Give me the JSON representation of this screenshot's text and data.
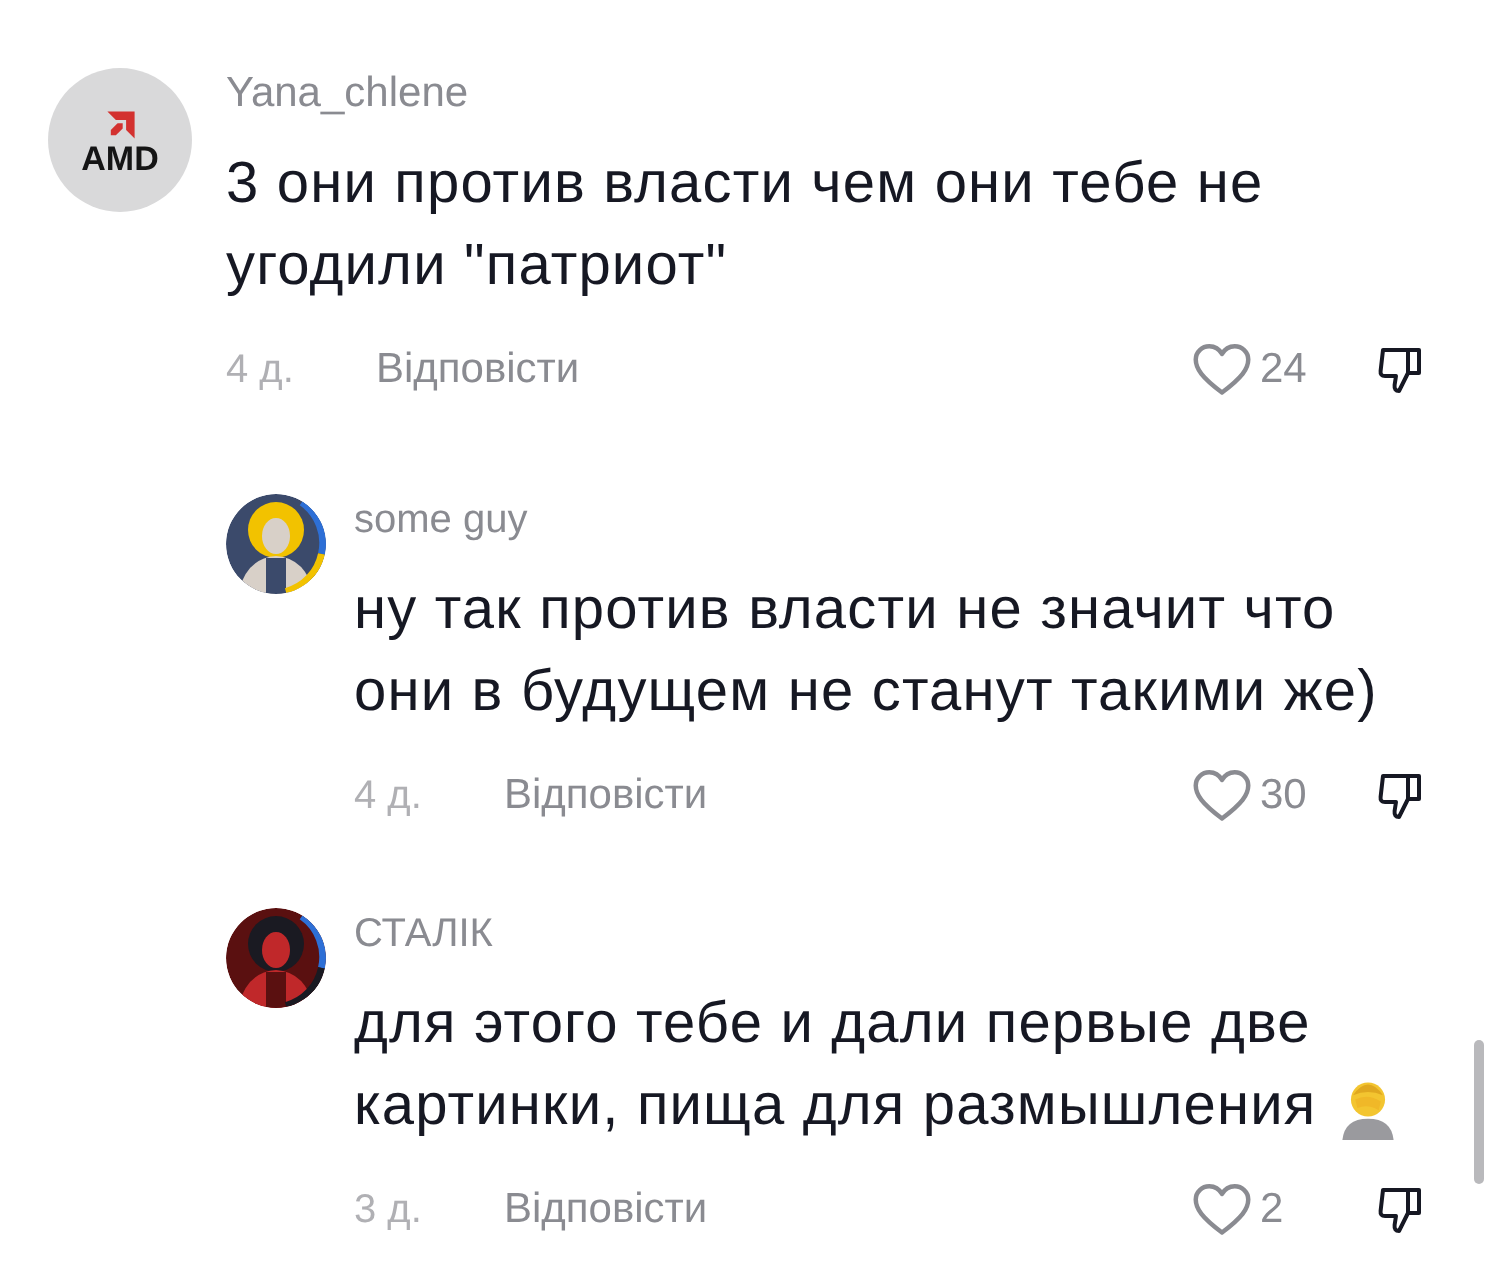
{
  "comments": [
    {
      "kind": "top",
      "avatar": {
        "kind": "logo",
        "text": "AMD"
      },
      "username": "Yana_chlene",
      "text": "3 они против власти чем они тебе не угодили \"патриот\"",
      "time": "4 д.",
      "reply_label": "Відповісти",
      "likes": "24",
      "liked": false
    },
    {
      "kind": "reply",
      "username": "some guy",
      "text": "ну так против власти не значит что они в будущем не станут такими же)",
      "time": "4 д.",
      "reply_label": "Відповісти",
      "likes": "30",
      "liked": false
    },
    {
      "kind": "reply",
      "username": "СТАЛІК",
      "text": "для этого тебе и дали первые две картинки, пища для размышления",
      "has_emoji": true,
      "time": "3 д.",
      "reply_label": "Відповісти",
      "likes": "2",
      "liked": false
    }
  ]
}
